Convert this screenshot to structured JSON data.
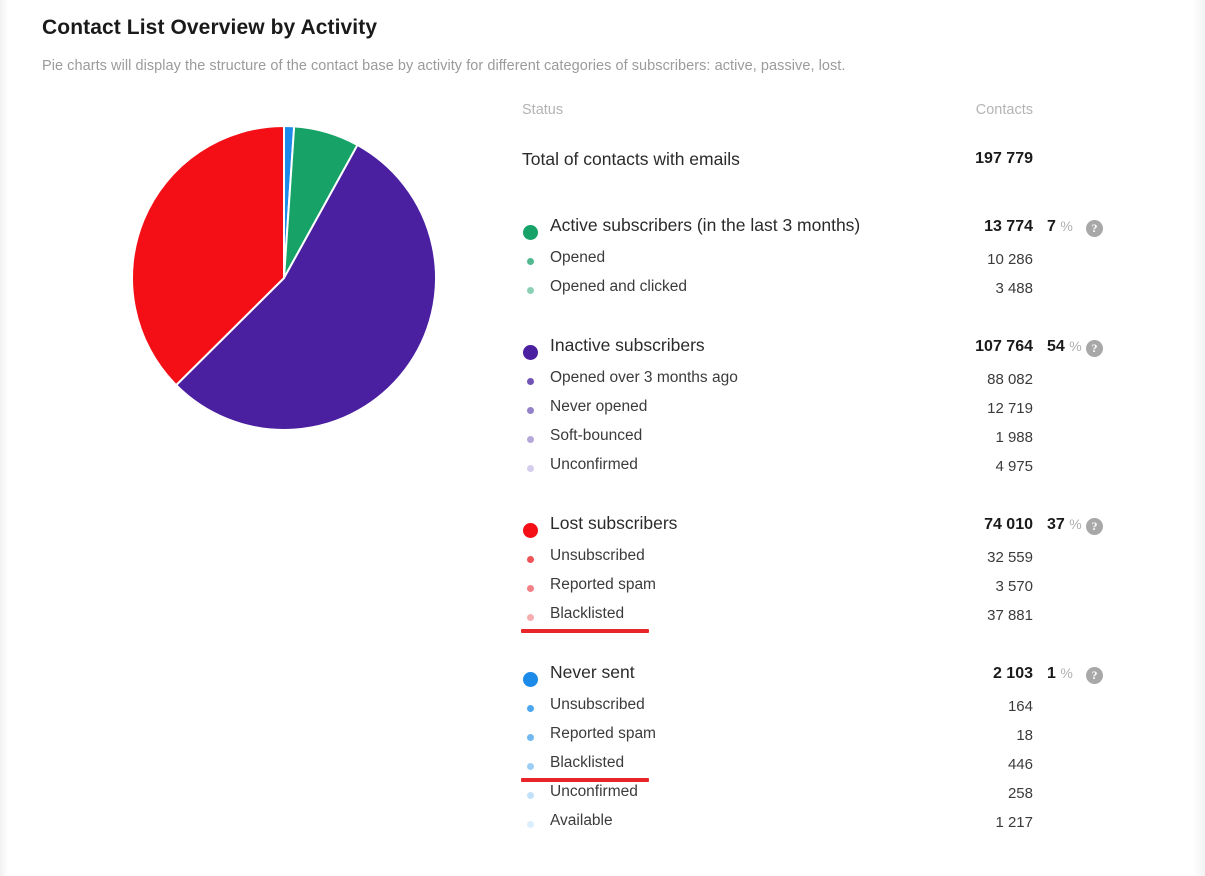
{
  "page": {
    "title": "Contact List Overview by Activity",
    "subtitle": "Pie charts will display the structure of the contact base by activity for different categories of subscribers: active, passive, lost."
  },
  "table": {
    "header_status": "Status",
    "header_contacts": "Contacts",
    "total_label": "Total of contacts with emails",
    "total_value": "197 779",
    "help_icon": "?",
    "percent_symbol": "%"
  },
  "groups": [
    {
      "label": "Active subscribers (in the last 3 months)",
      "value": "13 774",
      "percent": "7",
      "color": "#17a368",
      "items": [
        {
          "label": "Opened",
          "value": "10 286",
          "color": "#52b98e"
        },
        {
          "label": "Opened and clicked",
          "value": "3 488",
          "color": "#8bd0b4"
        }
      ]
    },
    {
      "label": "Inactive subscribers",
      "value": "107 764",
      "percent": "54",
      "color": "#4a1fa0",
      "items": [
        {
          "label": "Opened over 3 months ago",
          "value": "88 082",
          "color": "#7153b8"
        },
        {
          "label": "Never opened",
          "value": "12 719",
          "color": "#9481c9"
        },
        {
          "label": "Soft-bounced",
          "value": "1 988",
          "color": "#b4a8da"
        },
        {
          "label": "Unconfirmed",
          "value": "4 975",
          "color": "#d4cdeb"
        }
      ]
    },
    {
      "label": "Lost subscribers",
      "value": "74 010",
      "percent": "37",
      "color": "#f40f16",
      "items": [
        {
          "label": "Unsubscribed",
          "value": "32 559",
          "color": "#ef5257",
          "underlined": false
        },
        {
          "label": "Reported spam",
          "value": "3 570",
          "color": "#f28186",
          "underlined": false
        },
        {
          "label": "Blacklisted",
          "value": "37 881",
          "color": "#f6aeb1",
          "underlined": true
        }
      ]
    },
    {
      "label": "Never sent",
      "value": "2 103",
      "percent": "1",
      "color": "#1b8ae8",
      "items": [
        {
          "label": "Unsubscribed",
          "value": "164",
          "color": "#4ea6ee",
          "underlined": false
        },
        {
          "label": "Reported spam",
          "value": "18",
          "color": "#72b9f2",
          "underlined": false
        },
        {
          "label": "Blacklisted",
          "value": "446",
          "color": "#9ccff6",
          "underlined": true
        },
        {
          "label": "Unconfirmed",
          "value": "258",
          "color": "#c3e1fa",
          "underlined": false
        },
        {
          "label": "Available",
          "value": "1 217",
          "color": "#dceefc",
          "underlined": false
        }
      ]
    }
  ],
  "chart_data": {
    "type": "pie",
    "title": "Contact List Overview by Activity",
    "legend_position": "right",
    "total": 197779,
    "labels": [
      "Never sent",
      "Active subscribers (in the last 3 months)",
      "Inactive subscribers",
      "Lost subscribers"
    ],
    "values": [
      2103,
      13774,
      107764,
      74010
    ],
    "percentages": [
      1,
      7,
      54,
      37
    ],
    "colors": [
      "#1b8ae8",
      "#17a368",
      "#4a1fa0",
      "#f40f16"
    ],
    "start_angle_deg": 0,
    "direction": "clockwise",
    "slice_gap": "white separator"
  }
}
